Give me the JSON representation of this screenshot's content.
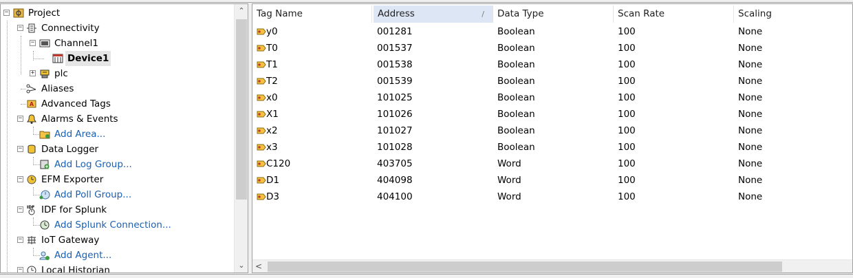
{
  "tree": {
    "nodes": [
      {
        "label": "Project",
        "icon": "project-icon",
        "expander": "−"
      },
      {
        "label": "Connectivity",
        "icon": "connectivity-icon",
        "expander": "−"
      },
      {
        "label": "Channel1",
        "icon": "channel-icon",
        "expander": "−"
      },
      {
        "label": "Device1",
        "icon": "device-icon",
        "expander": ""
      },
      {
        "label": "plc",
        "icon": "plc-icon",
        "expander": "+"
      },
      {
        "label": "Aliases",
        "icon": "aliases-icon",
        "expander": ""
      },
      {
        "label": "Advanced Tags",
        "icon": "advanced-tags-icon",
        "expander": ""
      },
      {
        "label": "Alarms & Events",
        "icon": "alarm-bell-icon",
        "expander": "−"
      },
      {
        "label": "Add Area...",
        "icon": "add-area-icon",
        "expander": ""
      },
      {
        "label": "Data Logger",
        "icon": "data-logger-icon",
        "expander": "−"
      },
      {
        "label": "Add Log Group...",
        "icon": "add-log-group-icon",
        "expander": ""
      },
      {
        "label": "EFM Exporter",
        "icon": "efm-exporter-icon",
        "expander": "−"
      },
      {
        "label": "Add Poll Group...",
        "icon": "add-poll-group-icon",
        "expander": ""
      },
      {
        "label": "IDF for Splunk",
        "icon": "idf-splunk-icon",
        "expander": "−"
      },
      {
        "label": "Add Splunk Connection...",
        "icon": "add-splunk-connection-icon",
        "expander": ""
      },
      {
        "label": "IoT Gateway",
        "icon": "iot-gateway-icon",
        "expander": "−"
      },
      {
        "label": "Add Agent...",
        "icon": "add-agent-icon",
        "expander": ""
      },
      {
        "label": "Local Historian",
        "icon": "local-historian-icon",
        "expander": "−"
      }
    ]
  },
  "table": {
    "columns": [
      "Tag Name",
      "Address",
      "Data Type",
      "Scan Rate",
      "Scaling"
    ],
    "sort_indicator": "/",
    "rows": [
      [
        "y0",
        "001281",
        "Boolean",
        "100",
        "None"
      ],
      [
        "T0",
        "001537",
        "Boolean",
        "100",
        "None"
      ],
      [
        "T1",
        "001538",
        "Boolean",
        "100",
        "None"
      ],
      [
        "T2",
        "001539",
        "Boolean",
        "100",
        "None"
      ],
      [
        "x0",
        "101025",
        "Boolean",
        "100",
        "None"
      ],
      [
        "X1",
        "101026",
        "Boolean",
        "100",
        "None"
      ],
      [
        "x2",
        "101027",
        "Boolean",
        "100",
        "None"
      ],
      [
        "x3",
        "101028",
        "Boolean",
        "100",
        "None"
      ],
      [
        "C120",
        "403705",
        "Word",
        "100",
        "None"
      ],
      [
        "D1",
        "404098",
        "Word",
        "100",
        "None"
      ],
      [
        "D3",
        "404100",
        "Word",
        "100",
        "None"
      ]
    ]
  },
  "scroll": {
    "up": "⌃",
    "down": "⌄",
    "left": "<"
  },
  "colors": {
    "link": "#1a5fb4",
    "selection": "#e5e5e5",
    "sorted_header": "#dce6f4"
  }
}
